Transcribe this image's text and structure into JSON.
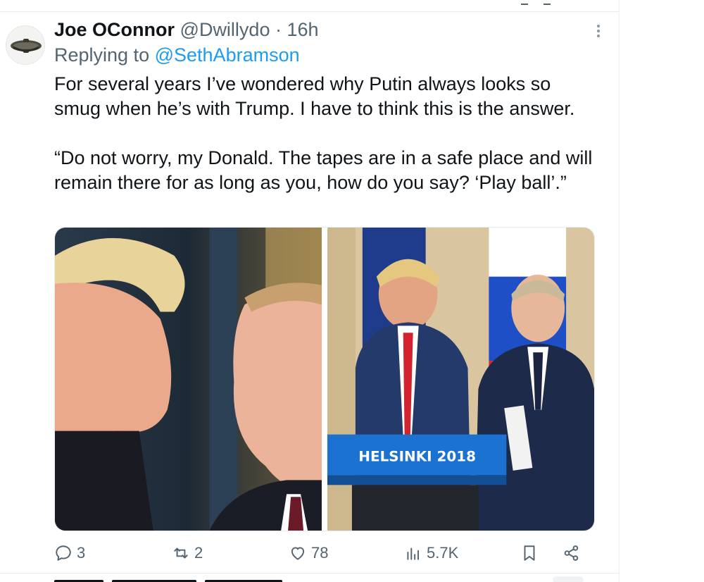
{
  "tweet": {
    "author": {
      "name": "Joe OConnor",
      "handle": "@Dwillydo"
    },
    "separator": "·",
    "timestamp": "16h",
    "replying_prefix": "Replying to",
    "replying_to": "@SethAbramson",
    "text_paragraphs": [
      "For several years I’ve wondered why Putin always looks so smug when he’s with Trump. I have to think this is the answer.",
      "“Do not worry, my Donald. The tapes are in a safe place and will remain there for as long as you, how do you say? ‘Play ball’.”"
    ],
    "media": {
      "photo_right_sign": "HELSINKI 2018"
    },
    "actions": {
      "replies": "3",
      "reposts": "2",
      "likes": "78",
      "views": "5.7K"
    }
  },
  "icons": {
    "more": "more-dots-icon",
    "reply": "speech-bubble-icon",
    "repost": "repost-arrows-icon",
    "like": "heart-icon",
    "views": "bar-chart-icon",
    "bookmark": "bookmark-icon",
    "share": "share-icon"
  },
  "colors": {
    "link": "#1d9bf0",
    "muted": "#536471",
    "text": "#0f1419",
    "divider": "#e6ecf0"
  }
}
